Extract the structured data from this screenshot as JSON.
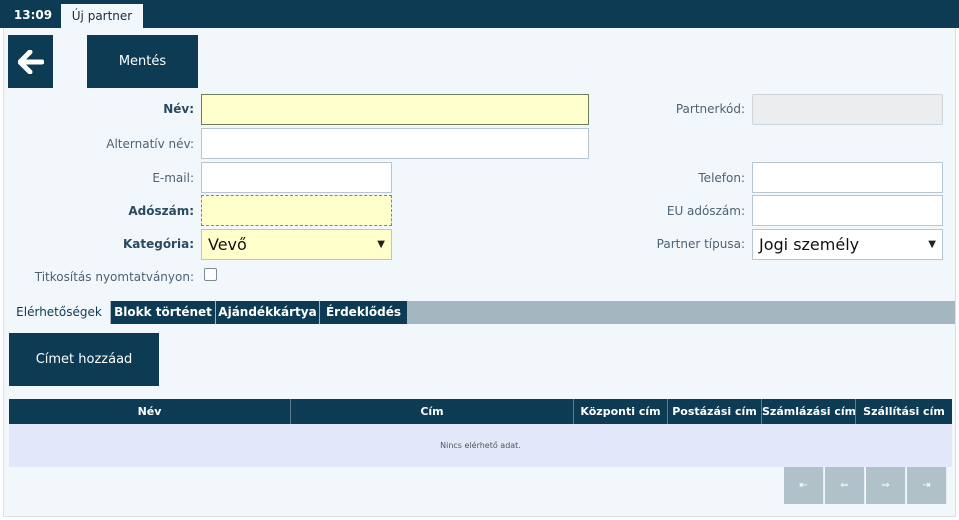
{
  "topbar": {
    "clock": "13:09",
    "tab_label": "Új partner"
  },
  "toolbar": {
    "back_icon": "arrow-left-icon",
    "save_label": "Mentés"
  },
  "form": {
    "name_label": "Név:",
    "name_value": "",
    "alt_name_label": "Alternatív név:",
    "alt_name_value": "",
    "partner_code_label": "Partnerkód:",
    "partner_code_value": "",
    "email_label": "E-mail:",
    "email_value": "",
    "phone_label": "Telefon:",
    "phone_value": "",
    "tax_label": "Adószám:",
    "tax_value": "",
    "eu_tax_label": "EU adószám:",
    "eu_tax_value": "",
    "category_label": "Kategória:",
    "category_value": "Vevő",
    "partner_type_label": "Partner típusa:",
    "partner_type_value": "Jogi személy",
    "encrypt_label": "Titkosítás nyomtatványon:",
    "encrypt_checked": false
  },
  "tabs": [
    {
      "label": "Elérhetőségek",
      "active": true
    },
    {
      "label": "Blokk történet",
      "active": false
    },
    {
      "label": "Ajándékkártya",
      "active": false
    },
    {
      "label": "Érdeklődés",
      "active": false
    }
  ],
  "addresses": {
    "add_label": "Címet hozzáad",
    "columns": [
      "Név",
      "Cím",
      "Központi cím",
      "Postázási cím",
      "Számlázási cím",
      "Szállítási cím"
    ],
    "empty_text": "Nincs elérhető adat."
  },
  "pager": {
    "first": "⇤",
    "prev": "⇐",
    "next": "⇒",
    "last": "⇥"
  },
  "colors": {
    "primary": "#0d3b53",
    "required_bg": "#ffffcc",
    "tabstrip": "#a4b7c1",
    "empty_row": "#e3e7fa"
  }
}
